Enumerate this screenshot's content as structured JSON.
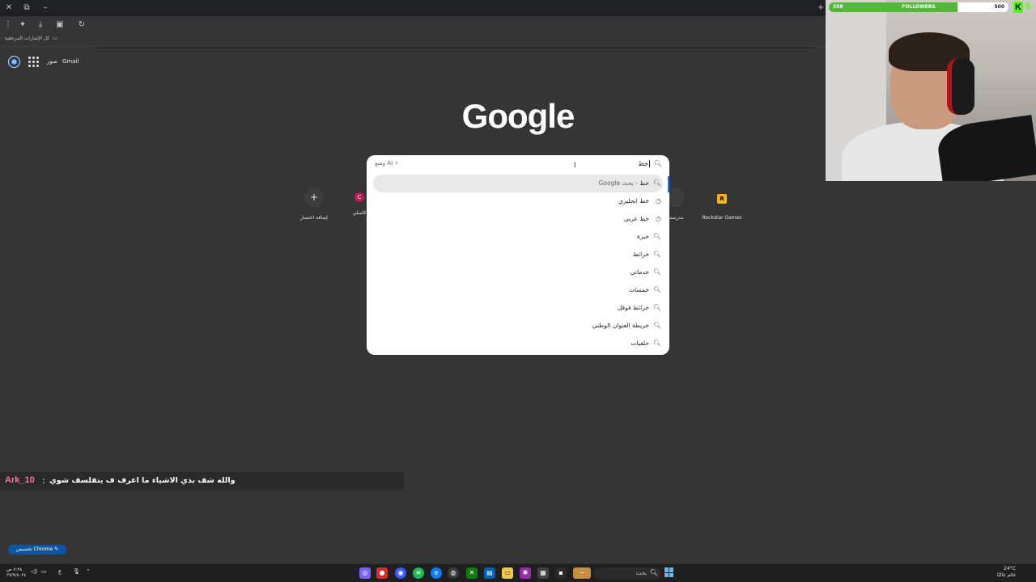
{
  "browser": {
    "bookmarks_all": "كل الإشارات المرجعية"
  },
  "ntp": {
    "link_images": "صور",
    "link_gmail": "Gmail",
    "logo": "Google",
    "customize": "تخصيص Chrome"
  },
  "search": {
    "query": "خط",
    "ai_mode": "وضع AI",
    "suggestions": [
      {
        "text": "خط",
        "suffix": " - بحث Google",
        "icon": "search-icon",
        "highlighted": true
      },
      {
        "text": "خط انجليزي",
        "icon": "history-icon"
      },
      {
        "text": "خط عربي",
        "icon": "history-icon"
      },
      {
        "text": "خبرة",
        "icon": "search-icon"
      },
      {
        "text": "خرائط",
        "icon": "search-icon"
      },
      {
        "text": "خدماتي",
        "icon": "search-icon"
      },
      {
        "text": "خمسات",
        "icon": "search-icon"
      },
      {
        "text": "خرائط قوقل",
        "icon": "search-icon"
      },
      {
        "text": "خريطة العنوان الوطني",
        "icon": "search-icon"
      },
      {
        "text": "خلفيات",
        "icon": "search-icon"
      }
    ]
  },
  "shortcuts": [
    {
      "label": "إضافة اختصار",
      "glyph": "+"
    },
    {
      "label": "كامبلي",
      "glyph": "C"
    },
    {
      "label": "مدرستي",
      "glyph": ""
    },
    {
      "label": "Rockstar Games",
      "glyph": "R"
    }
  ],
  "chat": {
    "user": "Ark_10",
    "separator": ":",
    "message": "والله شف بذي الاشياء ما اعرف ف يتقلسف شوي"
  },
  "stream": {
    "followers_current": "358",
    "followers_label": "FOLLOWERS",
    "followers_goal": "500",
    "followers_fraction": 0.716,
    "kick_logo": "K",
    "kick_count": "6"
  },
  "taskbar": {
    "search_placeholder": "بحث",
    "weather_temp": "24°C",
    "weather_desc": "غائم غالبًا",
    "clock_time": "٧:٢٨ ص",
    "clock_date": "٢٧/٧/٨٠٢٤",
    "lang": "ع"
  },
  "colors": {
    "accent": "#1a73e8",
    "chat_user": "#ff6fa8",
    "kick_green": "#53fc18",
    "follower_bar": "#53b83a"
  }
}
